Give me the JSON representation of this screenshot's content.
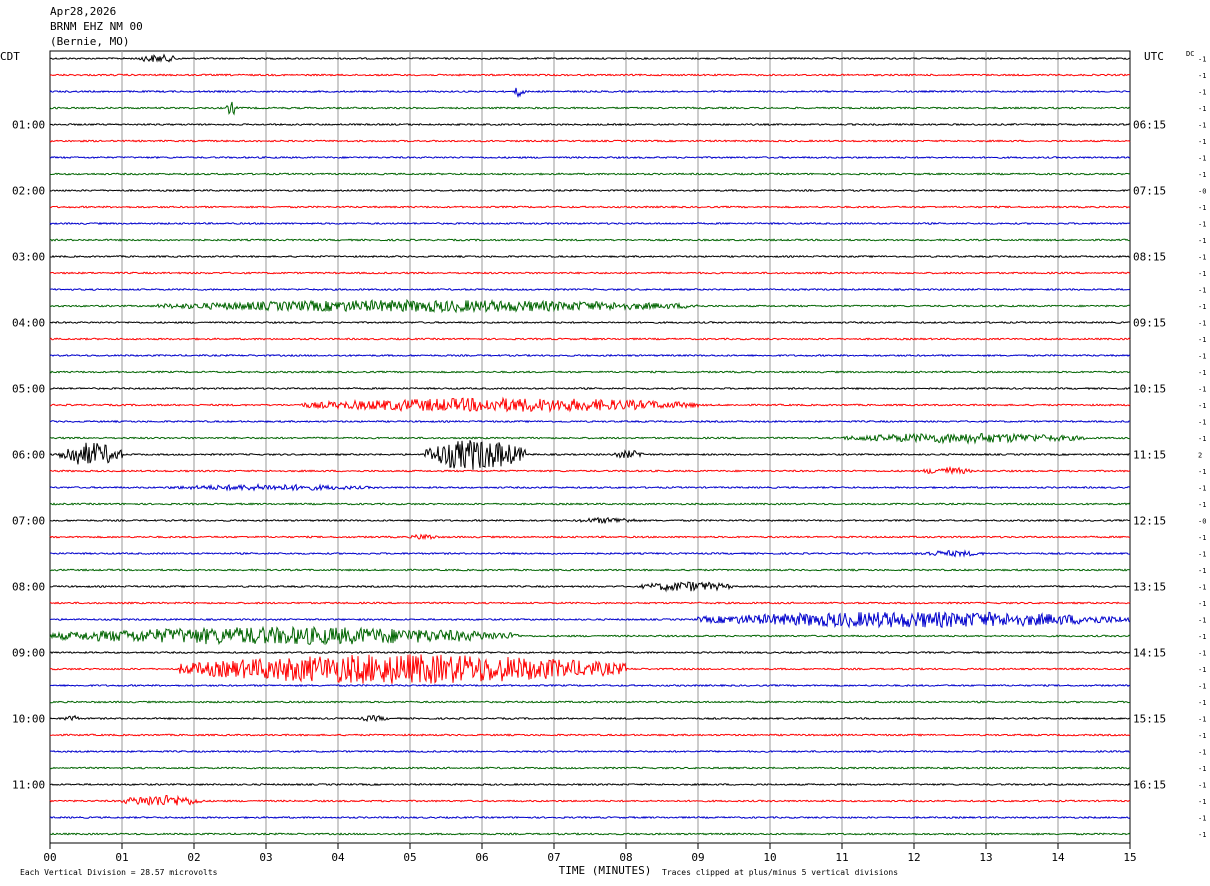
{
  "header": {
    "date": "Apr28,2026",
    "station": "BRNM EHZ NM 00",
    "location": "(Bernie, MO)"
  },
  "chart_data": {
    "type": "line",
    "left_axis_label": "CDT",
    "right_axis_label": "UTC",
    "dc_label": "DC",
    "x_axis_title": "TIME (MINUTES)",
    "x_ticks": [
      "00",
      "01",
      "02",
      "03",
      "04",
      "05",
      "06",
      "07",
      "08",
      "09",
      "10",
      "11",
      "12",
      "13",
      "14",
      "15"
    ],
    "xlim": [
      0,
      15
    ],
    "trace_count": 48,
    "trace_colors": [
      "#000000",
      "#ff0000",
      "#0000cc",
      "#006400"
    ],
    "left_hour_labels": [
      {
        "trace": 4,
        "label": "01:00"
      },
      {
        "trace": 8,
        "label": "02:00"
      },
      {
        "trace": 12,
        "label": "03:00"
      },
      {
        "trace": 16,
        "label": "04:00"
      },
      {
        "trace": 20,
        "label": "05:00"
      },
      {
        "trace": 24,
        "label": "06:00"
      },
      {
        "trace": 28,
        "label": "07:00"
      },
      {
        "trace": 32,
        "label": "08:00"
      },
      {
        "trace": 36,
        "label": "09:00"
      },
      {
        "trace": 40,
        "label": "10:00"
      },
      {
        "trace": 44,
        "label": "11:00"
      }
    ],
    "right_hour_labels": [
      {
        "trace": 4,
        "label": "06:15"
      },
      {
        "trace": 8,
        "label": "07:15"
      },
      {
        "trace": 12,
        "label": "08:15"
      },
      {
        "trace": 16,
        "label": "09:15"
      },
      {
        "trace": 20,
        "label": "10:15"
      },
      {
        "trace": 24,
        "label": "11:15"
      },
      {
        "trace": 28,
        "label": "12:15"
      },
      {
        "trace": 32,
        "label": "13:15"
      },
      {
        "trace": 36,
        "label": "14:15"
      },
      {
        "trace": 40,
        "label": "15:15"
      },
      {
        "trace": 44,
        "label": "16:15"
      }
    ],
    "dc_offsets": [
      "-1",
      "-1",
      "-1",
      "-1",
      "-1",
      "-1",
      "-1",
      "-1",
      "-0",
      "-1",
      "-1",
      "-1",
      "-1",
      "-1",
      "-1",
      "-1",
      "-1",
      "-1",
      "-1",
      "-1",
      "-1",
      "-1",
      "-1",
      "-1",
      "2",
      "-1",
      "-1",
      "-1",
      "-0",
      "-1",
      "-1",
      "-1",
      "-1",
      "-1",
      "-1",
      "-1",
      "-1",
      "-1",
      "-1",
      "-1",
      "-1",
      "-1",
      "-1",
      "-1",
      "-1",
      "-1",
      "-1",
      "-1"
    ],
    "events": [
      {
        "trace": 0,
        "start": 1.2,
        "end": 1.8,
        "amplitude": 4
      },
      {
        "trace": 2,
        "start": 6.45,
        "end": 6.6,
        "amplitude": 6
      },
      {
        "trace": 3,
        "start": 2.45,
        "end": 2.6,
        "amplitude": 7
      },
      {
        "trace": 15,
        "start": 1.5,
        "end": 9.0,
        "amplitude": 6
      },
      {
        "trace": 21,
        "start": 3.5,
        "end": 9.0,
        "amplitude": 7
      },
      {
        "trace": 23,
        "start": 11.0,
        "end": 14.4,
        "amplitude": 5
      },
      {
        "trace": 24,
        "start": 0.1,
        "end": 1.0,
        "amplitude": 12
      },
      {
        "trace": 24,
        "start": 5.2,
        "end": 6.6,
        "amplitude": 16
      },
      {
        "trace": 24,
        "start": 7.8,
        "end": 8.3,
        "amplitude": 4
      },
      {
        "trace": 25,
        "start": 12.1,
        "end": 12.8,
        "amplitude": 4
      },
      {
        "trace": 26,
        "start": 1.6,
        "end": 4.5,
        "amplitude": 3
      },
      {
        "trace": 28,
        "start": 7.3,
        "end": 8.2,
        "amplitude": 3
      },
      {
        "trace": 29,
        "start": 5.0,
        "end": 5.4,
        "amplitude": 3
      },
      {
        "trace": 30,
        "start": 12.0,
        "end": 13.0,
        "amplitude": 3
      },
      {
        "trace": 32,
        "start": 8.2,
        "end": 9.5,
        "amplitude": 5
      },
      {
        "trace": 34,
        "start": 9.0,
        "end": 15.0,
        "amplitude": 8
      },
      {
        "trace": 35,
        "start": 0.0,
        "end": 6.5,
        "amplitude": 9
      },
      {
        "trace": 37,
        "start": 1.8,
        "end": 8.0,
        "amplitude": 15
      },
      {
        "trace": 40,
        "start": 0.2,
        "end": 0.4,
        "amplitude": 4
      },
      {
        "trace": 40,
        "start": 4.3,
        "end": 4.7,
        "amplitude": 3
      },
      {
        "trace": 45,
        "start": 1.0,
        "end": 2.1,
        "amplitude": 6
      }
    ]
  },
  "footer": {
    "vertical_division": "Each Vertical Division =   28.57 microvolts",
    "clip_note": "Traces clipped at plus/minus 5 vertical divisions"
  }
}
